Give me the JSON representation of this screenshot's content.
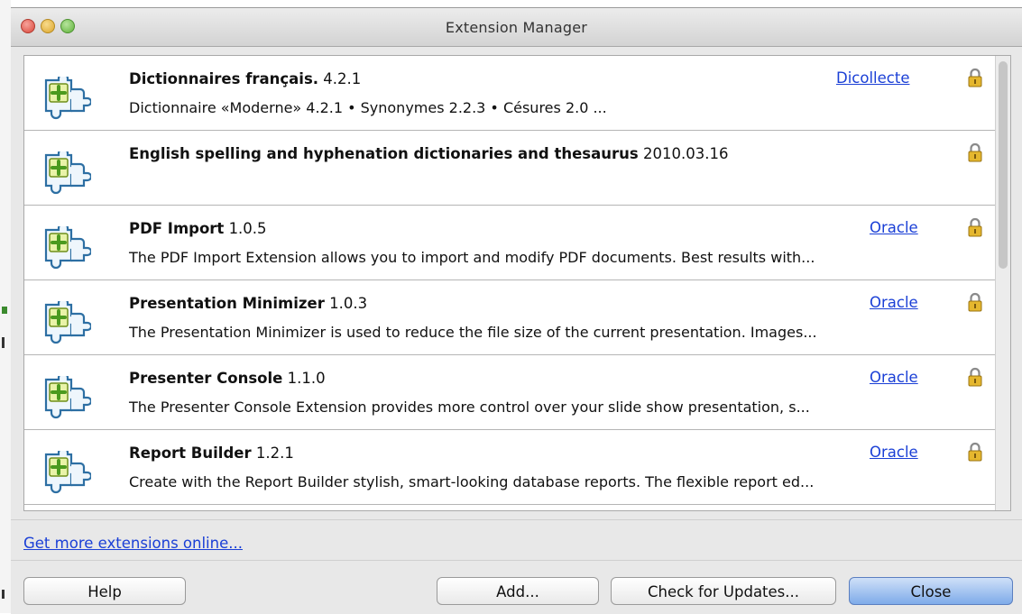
{
  "window": {
    "title": "Extension Manager"
  },
  "extensions": [
    {
      "name": "Dictionnaires français.",
      "version": "4.2.1",
      "description": "Dictionnaire «Moderne» 4.2.1 • Synonymes 2.2.3 • Césures 2.0  ...",
      "publisher": "Dicollecte"
    },
    {
      "name": "English spelling and hyphenation dictionaries and thesaurus",
      "version": "2010.03.16",
      "description": "",
      "publisher": ""
    },
    {
      "name": "PDF Import",
      "version": "1.0.5",
      "description": "The PDF Import Extension allows you to import and modify PDF documents. Best results with...",
      "publisher": "Oracle"
    },
    {
      "name": "Presentation Minimizer",
      "version": "1.0.3",
      "description": "The Presentation Minimizer is used to reduce the file size of the current presentation. Images...",
      "publisher": "Oracle"
    },
    {
      "name": "Presenter Console",
      "version": "1.1.0",
      "description": "The Presenter Console Extension provides more control over your slide show presentation, s...",
      "publisher": "Oracle"
    },
    {
      "name": "Report Builder",
      "version": "1.2.1",
      "description": "Create with the Report Builder stylish, smart-looking database reports. The flexible report ed...",
      "publisher": "Oracle"
    }
  ],
  "footer": {
    "more_link": "Get more extensions online...",
    "help_label": "Help",
    "add_label": "Add...",
    "check_updates_label": "Check for Updates...",
    "close_label": "Close"
  },
  "icons": {
    "extension": "puzzle-plus-icon",
    "lock": "lock-icon",
    "traffic_lights": [
      "close-dot",
      "minimize-dot",
      "zoom-dot"
    ]
  },
  "colors": {
    "link": "#1a3fd6",
    "default_button": "#7eabe9",
    "close_dot": "#e25b4e",
    "minimize_dot": "#e8b33c",
    "zoom_dot": "#6cbd44"
  }
}
